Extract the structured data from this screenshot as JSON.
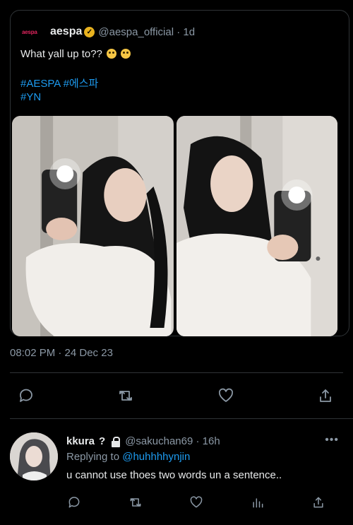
{
  "quoted_tweet": {
    "avatar_text": "aespa",
    "display_name": "aespa",
    "handle_time": "@aespa_official · 1d",
    "text": "What yall up to??",
    "emojis": [
      "face-with-monocle",
      "face-with-monocle"
    ],
    "hashtags_line1": "#AESPA #에스파",
    "hashtags_line2": "#YN",
    "photos": [
      "mirror-selfie-1",
      "mirror-selfie-2"
    ]
  },
  "timestamp": "08:02 PM · 24 Dec 23",
  "main_actions": [
    "reply-icon",
    "retweet-icon",
    "like-icon",
    "share-icon"
  ],
  "reply": {
    "display_name": "kkura",
    "name_suffix": "?",
    "handle_time": "@sakuchan69 · 16h",
    "replying_to_label": "Replying to",
    "replying_to_handle": "@huhhhhynjin",
    "text": "u cannot use thoes two words un a sentence..",
    "more_label": "•••",
    "actions": [
      "reply-icon",
      "retweet-icon",
      "like-icon",
      "analytics-icon",
      "share-icon"
    ]
  },
  "colors": {
    "background": "#000000",
    "text": "#e7e9ea",
    "secondary": "#8b98a5",
    "accent": "#1d9bf0",
    "verified": "#e8b21f",
    "border": "#2f3336"
  }
}
